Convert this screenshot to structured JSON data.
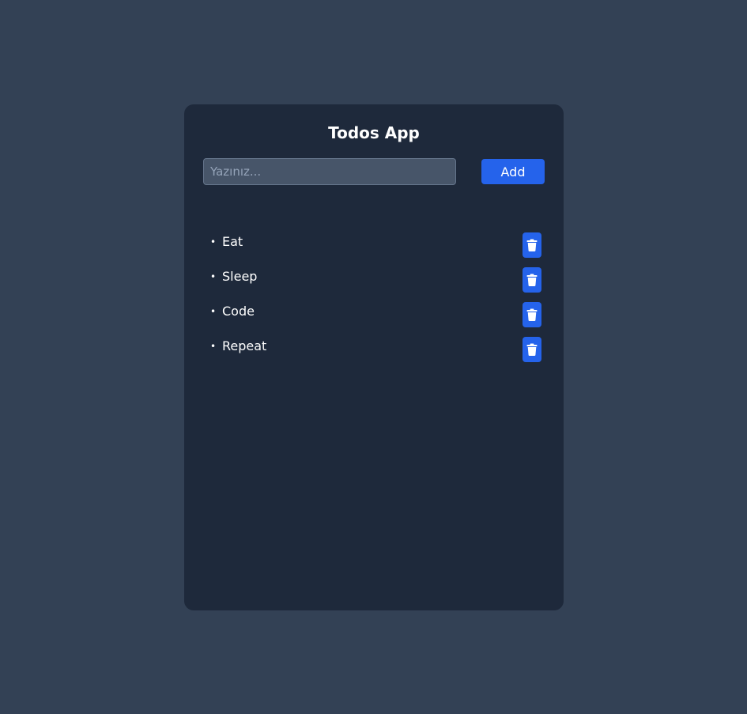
{
  "app": {
    "title": "Todos App"
  },
  "form": {
    "input_placeholder": "Yazınız...",
    "input_value": "",
    "add_label": "Add"
  },
  "todos": [
    {
      "text": "Eat",
      "delete_icon": "trash-icon"
    },
    {
      "text": "Sleep",
      "delete_icon": "trash-icon"
    },
    {
      "text": "Code",
      "delete_icon": "trash-icon"
    },
    {
      "text": "Repeat",
      "delete_icon": "trash-icon"
    }
  ],
  "colors": {
    "page_background": "#334155",
    "card_background": "#1e293b",
    "accent": "#2563eb",
    "input_background": "#475569",
    "text": "#ffffff"
  }
}
